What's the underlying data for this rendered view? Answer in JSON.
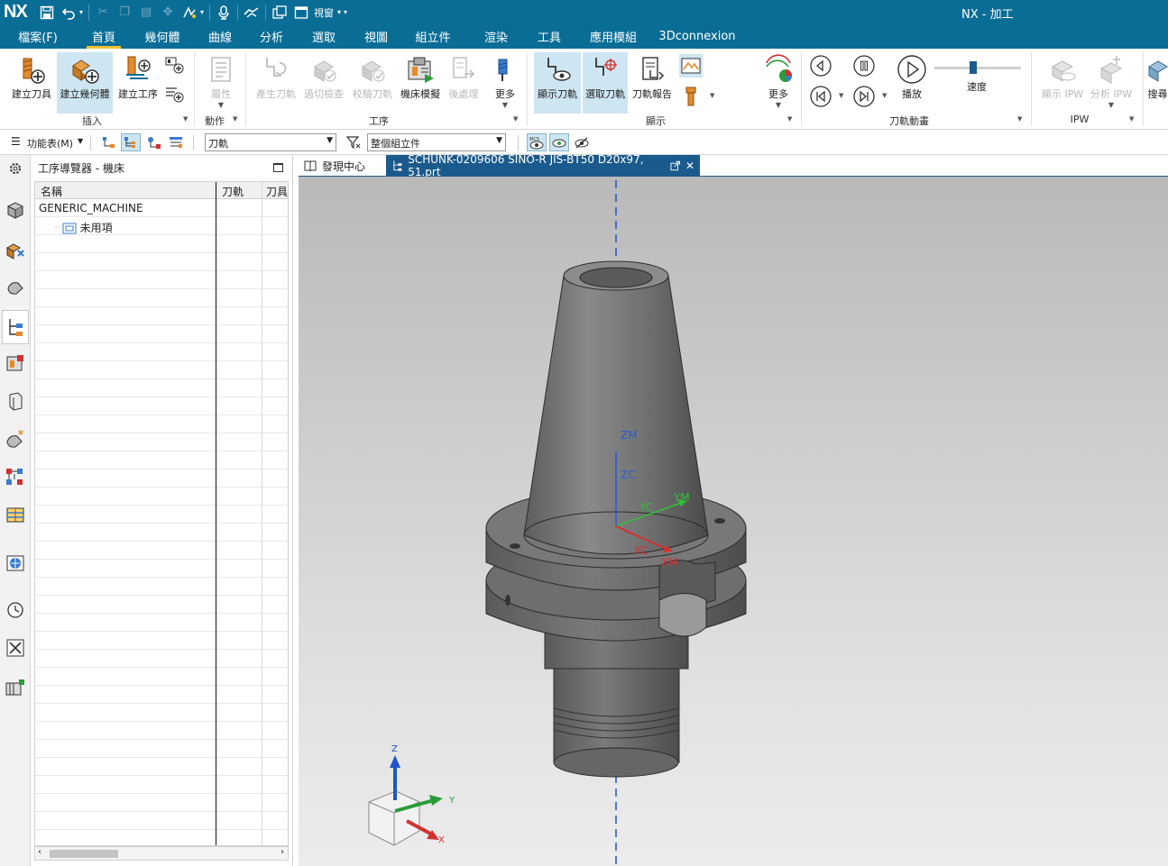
{
  "titlebar": {
    "logo": "NX",
    "window_menu_label": "視窗",
    "app_title": "NX - 加工"
  },
  "menu_tabs": [
    "檔案(F)",
    "首頁",
    "幾何體",
    "曲線",
    "分析",
    "選取",
    "視圖",
    "組立件",
    "渲染",
    "工具",
    "應用模組",
    "3Dconnexion"
  ],
  "active_tab": "首頁",
  "ribbon": {
    "create_tool": "建立刀具",
    "create_geometry": "建立幾何體",
    "create_operation": "建立工序",
    "attributes": "屬性",
    "generate_path": "產生刀軌",
    "gouge_check": "過切檢查",
    "verify_path": "校驗刀軌",
    "machine_sim": "機床模擬",
    "postprocess": "後處理",
    "more1": "更多",
    "show_path": "顯示刀軌",
    "select_path": "選取刀軌",
    "path_report": "刀軌報告",
    "more2": "更多",
    "play": "播放",
    "speed": "速度",
    "show_ipw": "顯示 IPW",
    "analyze_ipw": "分析 IPW",
    "search_cut": "搜尋",
    "groups": {
      "insert": "插入",
      "action": "動作",
      "operation": "工序",
      "display": "顯示",
      "path_anim": "刀軌動畫",
      "ipw": "IPW"
    }
  },
  "cmdbar": {
    "function_menu": "功能表(M)",
    "filter_value": "刀軌",
    "scope_value": "整個組立件"
  },
  "navigator": {
    "title": "工序導覽器 - 機床",
    "columns": [
      "名稱",
      "刀軌",
      "刀具"
    ],
    "rows": [
      {
        "name": "GENERIC_MACHINE",
        "indent": 0,
        "icon": false
      },
      {
        "name": "未用項",
        "indent": 1,
        "icon": true
      }
    ]
  },
  "doc_tabs": {
    "discover": "發現中心",
    "part": "SCHUNK-0209606 SINO-R JIS-BT50 D20x97, 51.prt"
  },
  "viewport": {
    "labels": {
      "zm": "ZM",
      "zc": "ZC",
      "yc": "YC",
      "ym": "YM",
      "xc": "XC",
      "xm": "XM"
    },
    "triad": {
      "z": "Z",
      "y": "Y",
      "x": "X"
    }
  },
  "colors": {
    "titlebar": "#0a6d96",
    "accent_tab": "#f2c230",
    "selected_button": "#cde6f2",
    "doc_tab_active": "#1b5a8c"
  }
}
